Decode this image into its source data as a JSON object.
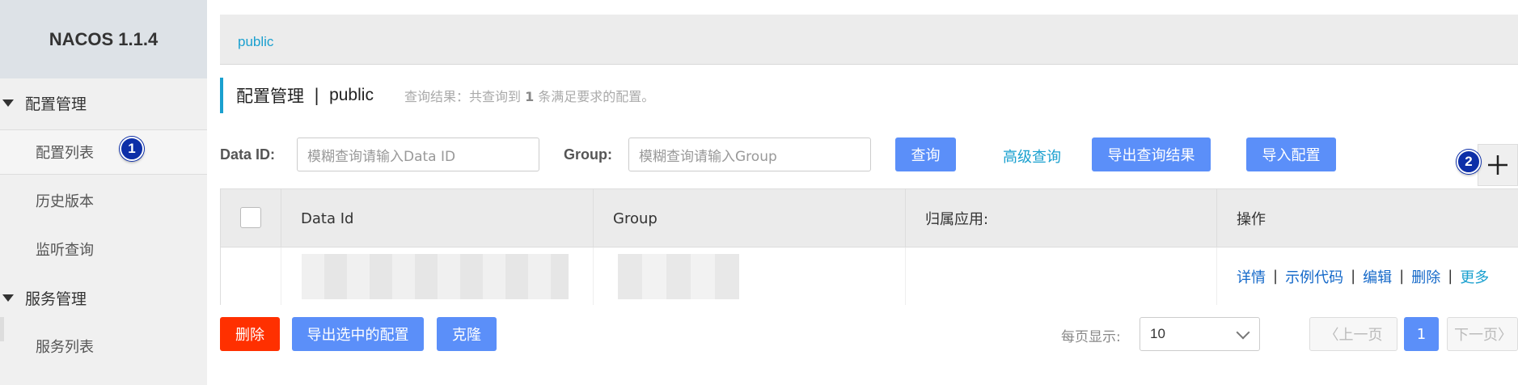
{
  "sidebar": {
    "brand": "NACOS 1.1.4",
    "groups": [
      {
        "label": "配置管理",
        "items": [
          "配置列表",
          "历史版本",
          "监听查询"
        ]
      },
      {
        "label": "服务管理",
        "items": [
          "服务列表"
        ]
      }
    ]
  },
  "badges": {
    "one": "1",
    "two": "2"
  },
  "namespace_bar": {
    "active": "public"
  },
  "title": {
    "main": "配置管理",
    "separator": "|",
    "namespace": "public",
    "summary_prefix": "查询结果：共查询到",
    "summary_count": "1",
    "summary_suffix": "条满足要求的配置。"
  },
  "search": {
    "data_id_label": "Data ID:",
    "data_id_placeholder": "模糊查询请输入Data ID",
    "group_label": "Group:",
    "group_placeholder": "模糊查询请输入Group",
    "query_button": "查询",
    "advanced_query": "高级查询",
    "export_results": "导出查询结果",
    "import_config": "导入配置"
  },
  "table": {
    "headers": [
      "Data Id",
      "Group",
      "归属应用:",
      "操作"
    ],
    "row_actions": [
      "详情",
      "示例代码",
      "编辑",
      "删除",
      "更多"
    ]
  },
  "footer": {
    "delete": "删除",
    "export_selected": "导出选中的配置",
    "clone": "克隆",
    "page_size_label": "每页显示:",
    "page_size_value": "10",
    "prev": "上一页",
    "current_page": "1",
    "next": "下一页"
  },
  "colors": {
    "primary_button": "#5b8ff9",
    "danger_button": "#ff3000",
    "link": "#1569c9",
    "accent": "#1aa0cf",
    "badge": "#0d2fa8"
  }
}
